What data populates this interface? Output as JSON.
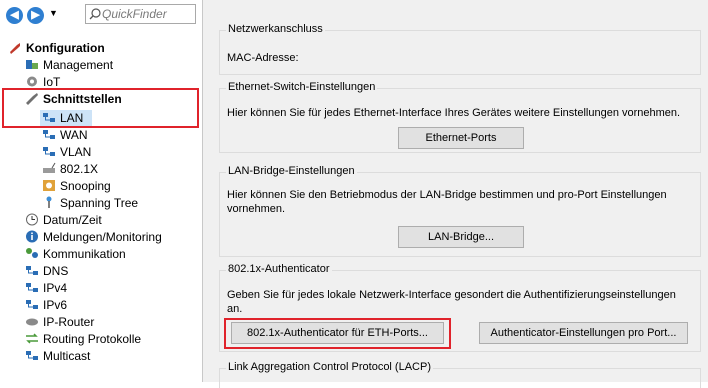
{
  "toolbar": {
    "search_placeholder": "QuickFinder"
  },
  "tree": [
    {
      "label": "Konfiguration",
      "icon": "wrench-icon",
      "bold": true
    },
    {
      "label": "Management",
      "icon": "management-icon"
    },
    {
      "label": "IoT",
      "icon": "gear-icon"
    },
    {
      "label": "Schnittstellen",
      "icon": "tools-icon"
    },
    {
      "label": "LAN",
      "icon": "lan-icon"
    },
    {
      "label": "WAN",
      "icon": "wan-icon"
    },
    {
      "label": "VLAN",
      "icon": "vlan-icon"
    },
    {
      "label": "802.1X",
      "icon": "802-icon"
    },
    {
      "label": "Snooping",
      "icon": "snooping-icon"
    },
    {
      "label": "Spanning Tree",
      "icon": "spanning-tree-icon"
    },
    {
      "label": "Datum/Zeit",
      "icon": "clock-icon"
    },
    {
      "label": "Meldungen/Monitoring",
      "icon": "info-icon"
    },
    {
      "label": "Kommunikation",
      "icon": "communication-icon"
    },
    {
      "label": "DNS",
      "icon": "network-icon"
    },
    {
      "label": "IPv4",
      "icon": "network-icon"
    },
    {
      "label": "IPv6",
      "icon": "network-icon"
    },
    {
      "label": "IP-Router",
      "icon": "router-icon"
    },
    {
      "label": "Routing Protokolle",
      "icon": "routing-icon"
    },
    {
      "label": "Multicast",
      "icon": "network-icon"
    }
  ],
  "groups": {
    "netzwerk": {
      "title": "Netzwerkanschluss",
      "text": "MAC-Adresse:"
    },
    "ethernet": {
      "title": "Ethernet-Switch-Einstellungen",
      "text": "Hier können Sie für jedes Ethernet-Interface Ihres Gerätes weitere Einstellungen vornehmen.",
      "button": "Ethernet-Ports"
    },
    "bridge": {
      "title": "LAN-Bridge-Einstellungen",
      "text1": "Hier können Sie den Betriebmodus der LAN-Bridge bestimmen und pro-Port Einstellungen",
      "text2": "vornehmen.",
      "button": "LAN-Bridge..."
    },
    "auth": {
      "title": "802.1x-Authenticator",
      "text1": "Geben Sie für jedes lokale Netzwerk-Interface gesondert die Authentifizierungseinstellungen",
      "text2": "an.",
      "button1": "802.1x-Authenticator für ETH-Ports...",
      "button2": "Authenticator-Einstellungen pro Port..."
    },
    "lacp": {
      "title": "Link Aggregation Control Protocol (LACP)"
    }
  }
}
